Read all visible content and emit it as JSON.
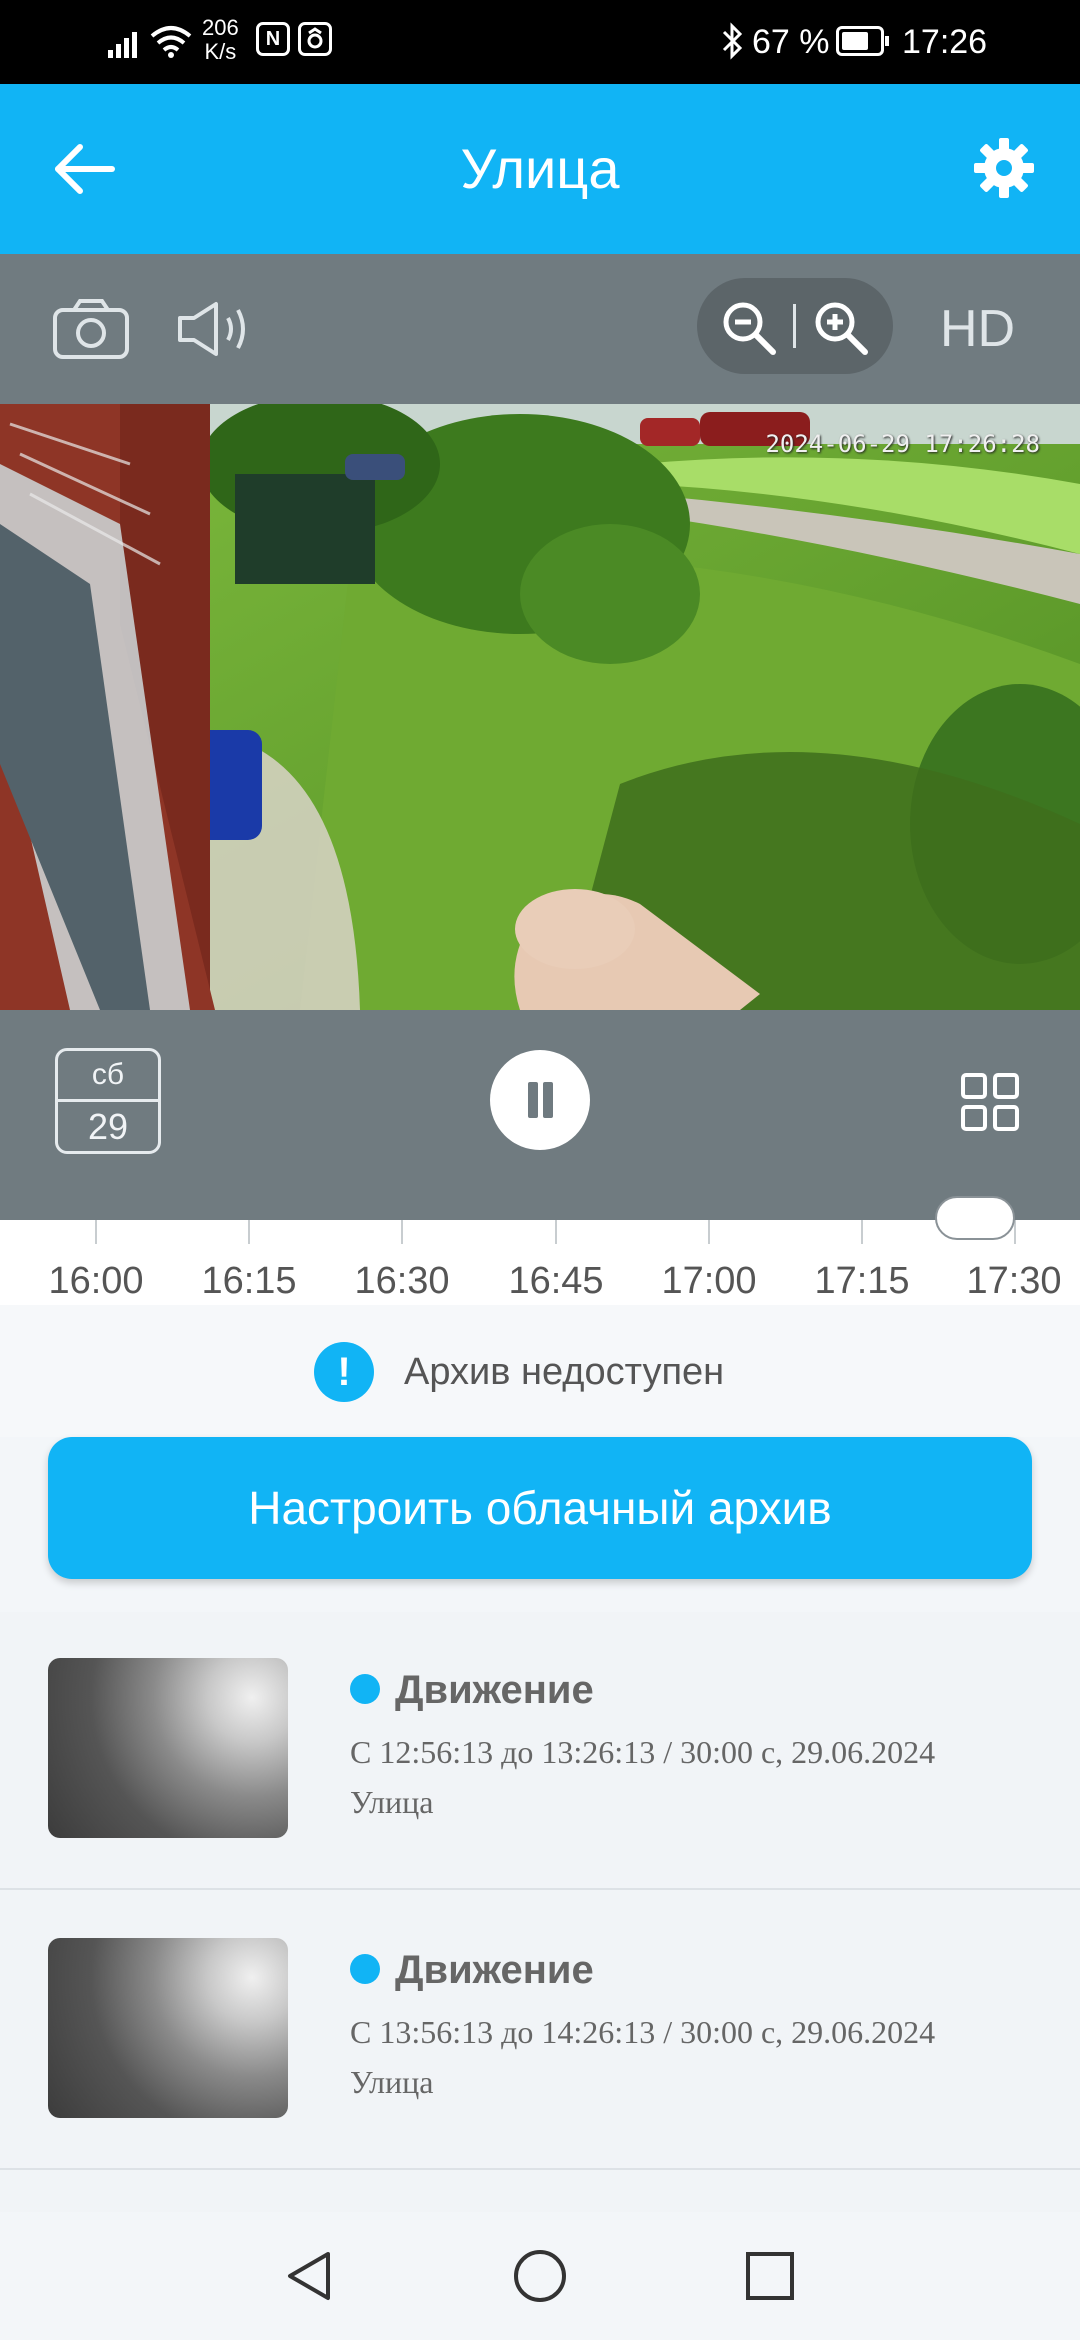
{
  "status_bar": {
    "network_speed_value": "206",
    "network_speed_unit": "K/s",
    "nfc_badge": "N",
    "battery_percent": "67 %",
    "time": "17:26",
    "icons": [
      "signal-icon",
      "wifi-icon",
      "nfc-icon",
      "app-notification-icon",
      "bluetooth-icon",
      "battery-icon"
    ]
  },
  "header": {
    "title": "Улица",
    "back_icon": "arrow-left-icon",
    "settings_icon": "gear-icon",
    "background": "#11b4f5"
  },
  "controls": {
    "snapshot_icon": "camera-icon",
    "sound_icon": "speaker-icon",
    "zoom_out_icon": "zoom-out-icon",
    "zoom_in_icon": "zoom-in-icon",
    "quality_label": "HD"
  },
  "video": {
    "timestamp_overlay": "2024-06-29 17:26:28"
  },
  "playback": {
    "calendar_weekday": "сб",
    "calendar_day": "29",
    "pause_icon": "pause-icon",
    "layout_icon": "grid-icon"
  },
  "timeline": {
    "labels": [
      "16:00",
      "16:15",
      "16:30",
      "16:45",
      "17:00",
      "17:15",
      "17:30"
    ]
  },
  "archive": {
    "message": "Архив недоступен",
    "info_icon_glyph": "!",
    "cloud_button_label": "Настроить облачный архив"
  },
  "events": [
    {
      "type": "Движение",
      "time_range": "С 12:56:13 до 13:26:13 / 30:00 с, 29.06.2024",
      "camera": "Улица"
    },
    {
      "type": "Движение",
      "time_range": "С 13:56:13 до 14:26:13 / 30:00 с, 29.06.2024",
      "camera": "Улица"
    }
  ],
  "nav_bar": {
    "icons": [
      "nav-back-icon",
      "nav-home-icon",
      "nav-recents-icon"
    ]
  }
}
